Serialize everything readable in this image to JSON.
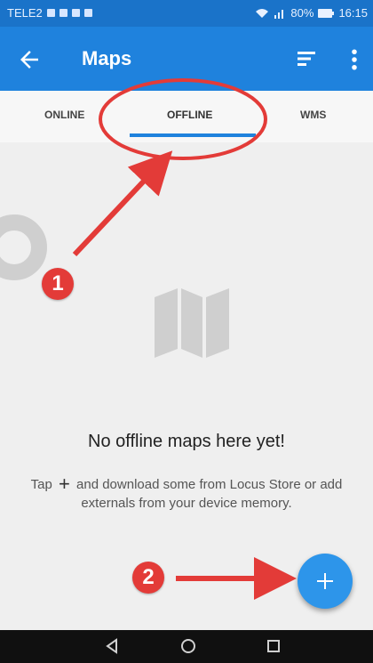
{
  "status_bar": {
    "carrier": "TELE2",
    "battery": "80%",
    "time": "16:15"
  },
  "app_bar": {
    "title": "Maps",
    "back_icon": "arrow-back-icon",
    "sort_icon": "sort-icon",
    "more_icon": "more-vert-icon"
  },
  "tabs": [
    {
      "label": "ONLINE"
    },
    {
      "label": "OFFLINE",
      "selected": true
    },
    {
      "label": "WMS"
    }
  ],
  "empty_state": {
    "icon": "map-icon",
    "title": "No offline maps here yet!",
    "desc_prefix": "Tap",
    "desc_plus": "+",
    "desc_rest": "and download some from Locus Store or add externals from your device memory."
  },
  "fab": {
    "icon": "plus-icon"
  },
  "annotations": {
    "badge_1": "1",
    "badge_2": "2",
    "color": "#e33b38"
  },
  "colors": {
    "app_bar": "#1f82dd",
    "status_bar": "#1a73c9",
    "accent": "#1f82dd",
    "background": "#efefef"
  }
}
